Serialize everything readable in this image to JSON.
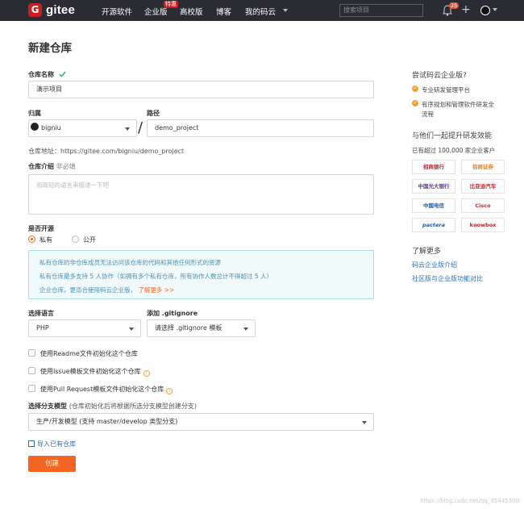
{
  "nav": {
    "logo_letter": "G",
    "logo_text": "gitee",
    "items": [
      "开源软件",
      "企业版",
      "高校版",
      "博客",
      "我的码云"
    ],
    "badge": "特惠",
    "search_placeholder": "搜索项目",
    "notif_count": "25"
  },
  "form": {
    "title": "新建仓库",
    "name_label": "仓库名称",
    "name_value": "演示项目",
    "owner_label": "归属",
    "owner_value": "bigniu",
    "path_label": "路径",
    "path_value": "demo_project",
    "address_text": "仓库地址：https://gitee.com/bigniu/demo_project",
    "desc_label": "仓库介绍",
    "desc_hint": "非必填",
    "desc_placeholder": "用简短的语言来描述一下吧",
    "open_label": "是否开源",
    "private_label": "私有",
    "public_label": "公开",
    "info": {
      "line1": "私有仓库的非仓库成员无法访问该仓库的代码和其他任何形式的资源",
      "line2": "私有仓库最多支持 5 人协作（如拥有多个私有仓库，所有协作人数总计不得超过 5 人）",
      "line3": "企业仓库，更适合使用码云企业版，",
      "line3_link": "了解更多 >>"
    },
    "lang_label": "选择语言",
    "lang_value": "PHP",
    "gitignore_label": "添加 .gitignore",
    "gitignore_value": "请选择 .gitignore 模板",
    "check_readme": "使用Readme文件初始化这个仓库",
    "check_issue": "使用Issue模板文件初始化这个仓库",
    "check_pr": "使用Pull Request模板文件初始化这个仓库",
    "branch_label": "选择分支模型",
    "branch_hint": "(仓库初始化后将根据所选分支模型创建分支)",
    "branch_value": "生产/开发模型 (支持 master/develop 类型分支)",
    "import_label": "导入已有仓库",
    "create_label": "创建"
  },
  "sidebar": {
    "try_title": "尝试码云企业版?",
    "try_items": [
      "专业研发管理平台",
      "有序规划和管理软件研发全",
      "流程"
    ],
    "together_title": "与他们一起提升研发效能",
    "customers_text": "已有超过 100,000 家企业客户",
    "logos": [
      "招商银行",
      "招商证券",
      "中国光大银行",
      "比亚迪汽车",
      "中国电信",
      "Cisco",
      "pactera",
      "knowbox"
    ],
    "more_title": "了解更多",
    "links": [
      "码云企业版介绍",
      "社区版与企业版功能对比"
    ]
  },
  "watermark": "https://blog.csdn.net/qq_35445300",
  "colors": {
    "brand": "#c71d23",
    "accent": "#f26522",
    "link": "#2a6ebb",
    "nav_bg": "#2a2b33"
  }
}
